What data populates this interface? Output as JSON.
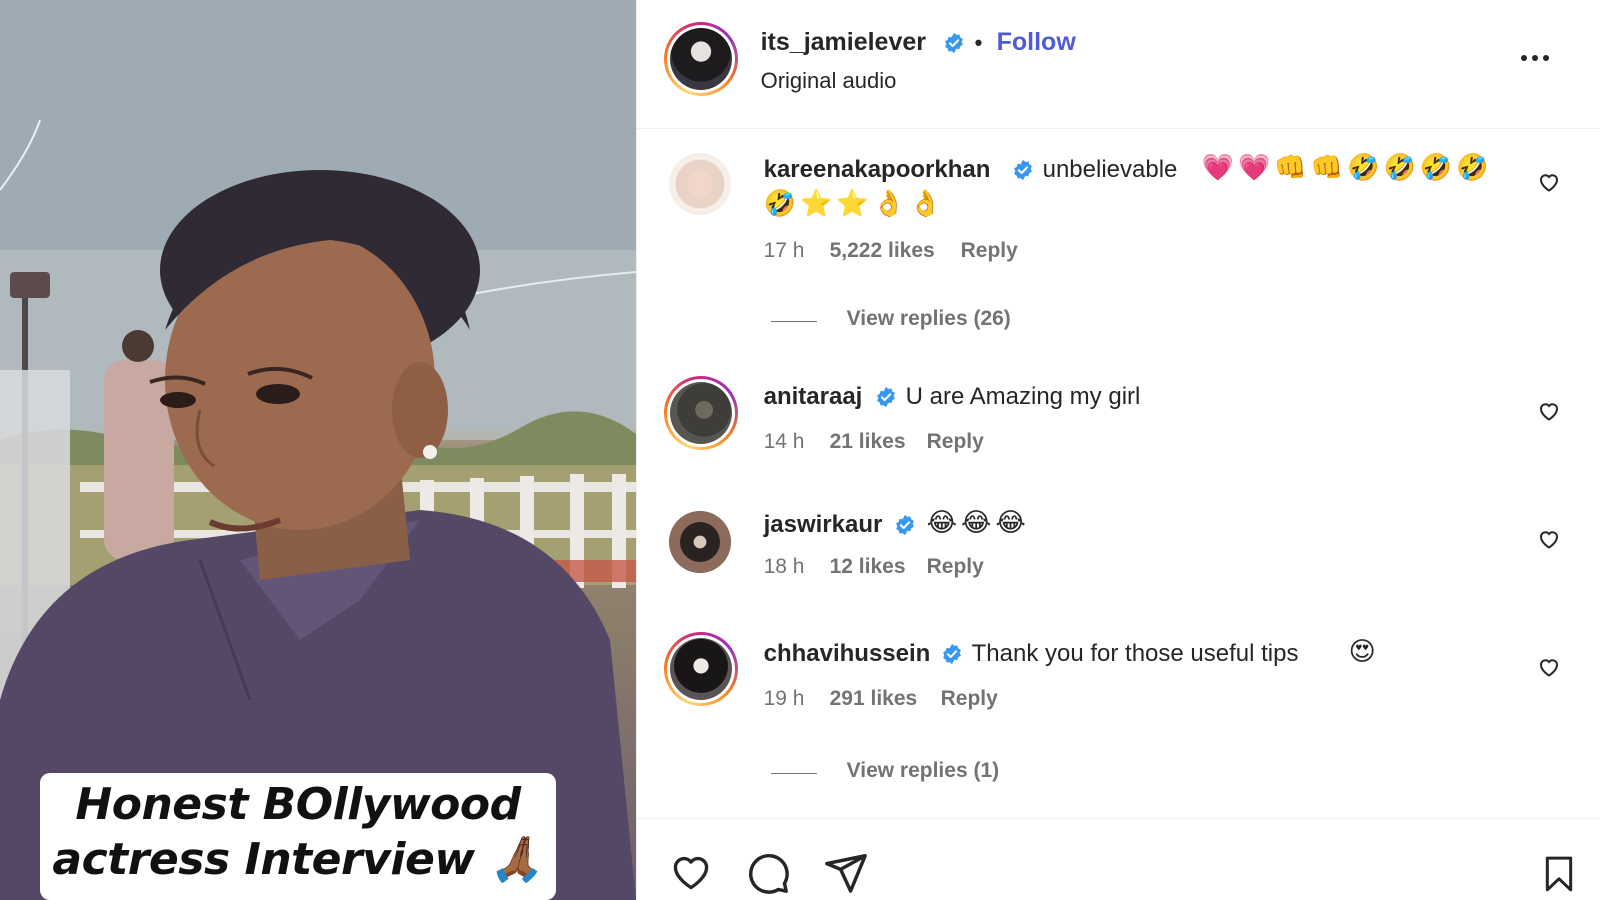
{
  "post": {
    "author": "its_jamielever",
    "separator": "•",
    "follow_label": "Follow",
    "audio": "Original audio",
    "media": {
      "caption_line1": "Honest BOllywood",
      "caption_line2": "actress Interview 🙏🏾"
    }
  },
  "comments": [
    {
      "username": "kareenakapoorkhan",
      "text": "unbelievable",
      "emoji_line1": "💗💗👊👊🤣🤣🤣🤣",
      "emoji_line2": "🤣⭐⭐👌👌",
      "time": "17 h",
      "likes": "5,222 likes",
      "reply_label": "Reply",
      "view_replies": "View replies (26)"
    },
    {
      "username": "anitaraaj",
      "text": "U are Amazing my girl",
      "time": "14 h",
      "likes": "21 likes",
      "reply_label": "Reply"
    },
    {
      "username": "jaswirkaur",
      "emoji_line1": "😂😂😂",
      "time": "18 h",
      "likes": "12 likes",
      "reply_label": "Reply"
    },
    {
      "username": "chhavihussein",
      "text": "Thank you for those useful tips",
      "emoji_line1": "😍",
      "time": "19 h",
      "likes": "291 likes",
      "reply_label": "Reply",
      "view_replies": "View replies (1)"
    }
  ],
  "icons": {
    "verified": "verified-badge-icon",
    "more": "more-options-icon",
    "comment_like": "heart-outline-icon",
    "like": "heart-icon",
    "comment": "comment-bubble-icon",
    "share": "paper-plane-icon",
    "save": "bookmark-icon"
  },
  "colors": {
    "follow": "#4f5bd5",
    "verified": "#3897f0",
    "muted_text": "#737373",
    "text": "#262626"
  }
}
